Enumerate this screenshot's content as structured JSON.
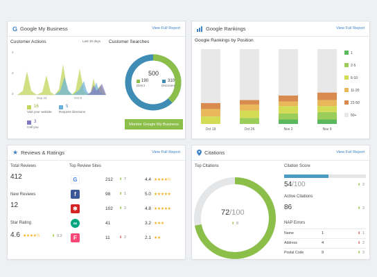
{
  "gmb": {
    "title": "Google My Business",
    "full_report": "View Full Report",
    "actions_title": "Customer Actions",
    "actions_period": "Last 30 days",
    "y_ticks": [
      "4",
      "2",
      "0"
    ],
    "x_ticks": [
      "Sep 24",
      "Oct 8"
    ],
    "legend": [
      {
        "value": "16",
        "label": "Visit your website",
        "color": "#c0d65a"
      },
      {
        "value": "5",
        "label": "Request directions",
        "color": "#6ab0d8"
      },
      {
        "value": "3",
        "label": "Call you",
        "color": "#7f79c0"
      }
    ],
    "searches_title": "Customer Searches",
    "donut_total": "500",
    "direct_value": "190",
    "direct_label": "Direct",
    "discovery_value": "310",
    "discovery_label": "Discovery",
    "direct_color": "#8cbf4a",
    "discovery_color": "#3f8cb5",
    "monitor_button": "Monitor Google My Business"
  },
  "rankings": {
    "title": "Google Rankings",
    "full_report": "View Full Report",
    "chart_title": "Google Rankings by Position",
    "legend": [
      {
        "label": "1",
        "color": "#5cb85c"
      },
      {
        "label": "2-5",
        "color": "#9ccc5a"
      },
      {
        "label": "6-10",
        "color": "#d4dc55"
      },
      {
        "label": "11-20",
        "color": "#e8b85a"
      },
      {
        "label": "21-50",
        "color": "#d98a4e"
      },
      {
        "label": "50+",
        "color": "#e8e8e8"
      }
    ]
  },
  "chart_data": {
    "type": "bar",
    "stacked": true,
    "categories": [
      "Oct 19",
      "Oct 26",
      "Nov 2",
      "Nov 9"
    ],
    "series": [
      {
        "name": "1",
        "values": [
          0,
          0,
          6,
          6
        ]
      },
      {
        "name": "2-5",
        "values": [
          0,
          8,
          8,
          10
        ]
      },
      {
        "name": "6-10",
        "values": [
          10,
          10,
          10,
          8
        ]
      },
      {
        "name": "11-20",
        "values": [
          10,
          8,
          6,
          8
        ]
      },
      {
        "name": "21-50",
        "values": [
          8,
          6,
          8,
          10
        ]
      },
      {
        "name": "50+",
        "values": [
          72,
          68,
          62,
          58
        ]
      }
    ]
  },
  "reviews": {
    "title": "Reviews & Ratings",
    "full_report": "View Full Report",
    "total_label": "Total Reviews",
    "total_value": "412",
    "new_label": "New Reviews",
    "new_value": "12",
    "star_label": "Star Rating",
    "star_value": "4.6",
    "star_delta": "0.2",
    "sites_title": "Top Review Sites",
    "sites": [
      {
        "icon": "google-icon",
        "glyph": "G",
        "color": "#ffffff",
        "fg": "#4285f4",
        "count": "212",
        "delta": "7",
        "dir": "up",
        "rating": "4.4",
        "stars": "★★★★½"
      },
      {
        "icon": "facebook-icon",
        "glyph": "f",
        "color": "#3b5998",
        "fg": "#ffffff",
        "count": "98",
        "delta": "1",
        "dir": "up",
        "rating": "5.0",
        "stars": "★★★★★"
      },
      {
        "icon": "yelp-icon",
        "glyph": "✱",
        "color": "#d32323",
        "fg": "#ffffff",
        "count": "102",
        "delta": "2",
        "dir": "up",
        "rating": "4.8",
        "stars": "★★★★★"
      },
      {
        "icon": "tripadvisor-icon",
        "glyph": "∞",
        "color": "#00a680",
        "fg": "#ffffff",
        "count": "41",
        "delta": "",
        "dir": "",
        "rating": "3.2",
        "stars": "★★★"
      },
      {
        "icon": "foursquare-icon",
        "glyph": "F",
        "color": "#f94877",
        "fg": "#ffffff",
        "count": "11",
        "delta": "2",
        "dir": "down",
        "rating": "2.1",
        "stars": "★★"
      }
    ]
  },
  "citations": {
    "title": "Citations",
    "full_report": "View Full Report",
    "top_title": "Top Citations",
    "score": "72",
    "score_max": "/100",
    "score_delta": "8",
    "citation_score_label": "Citation Score",
    "citation_score_value": "54",
    "citation_score_max": "/100",
    "citation_score_fraction": 0.54,
    "citation_score_delta": "2",
    "active_label": "Active Citations",
    "active_value": "86",
    "active_delta": "2",
    "nap_title": "NAP Errors",
    "nap": [
      {
        "label": "Name",
        "value": "1",
        "delta": "1",
        "dir": "down"
      },
      {
        "label": "Address",
        "value": "4",
        "delta": "2",
        "dir": "down"
      },
      {
        "label": "Postal Code",
        "value": "9",
        "delta": "2",
        "dir": "up"
      }
    ],
    "ring_color": "#8cbf4a",
    "ring_bg": "#e4e6e8",
    "bar_color": "#4b9cc4"
  }
}
